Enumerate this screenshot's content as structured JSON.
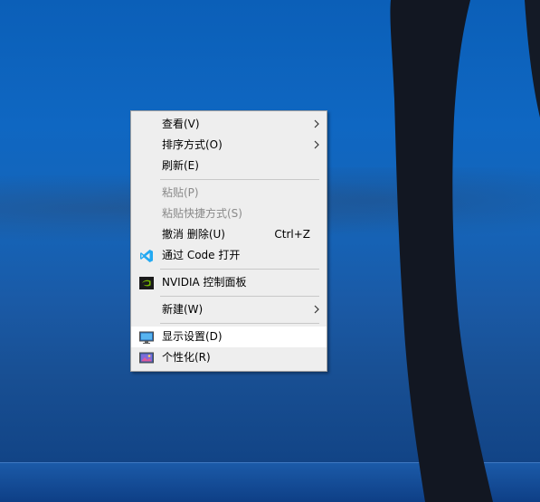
{
  "context_menu": {
    "items": [
      {
        "label": "查看(V)"
      },
      {
        "label": "排序方式(O)"
      },
      {
        "label": "刷新(E)"
      },
      {
        "label": "粘贴(P)"
      },
      {
        "label": "粘贴快捷方式(S)"
      },
      {
        "label": "撤消 删除(U)",
        "shortcut": "Ctrl+Z"
      },
      {
        "label": "通过 Code 打开"
      },
      {
        "label": "NVIDIA 控制面板"
      },
      {
        "label": "新建(W)"
      },
      {
        "label": "显示设置(D)"
      },
      {
        "label": "个性化(R)"
      }
    ]
  },
  "icons": {
    "vscode": "vscode-icon",
    "nvidia": "nvidia-icon",
    "display": "display-settings-icon",
    "personalize": "personalize-icon",
    "submenu": "chevron-right-icon"
  },
  "colors": {
    "menu_bg": "#eeeeee",
    "highlight_bg": "#ffffff",
    "disabled_text": "#8a8a8a",
    "vscode_blue": "#23a9f2",
    "nvidia_green": "#76b900"
  }
}
